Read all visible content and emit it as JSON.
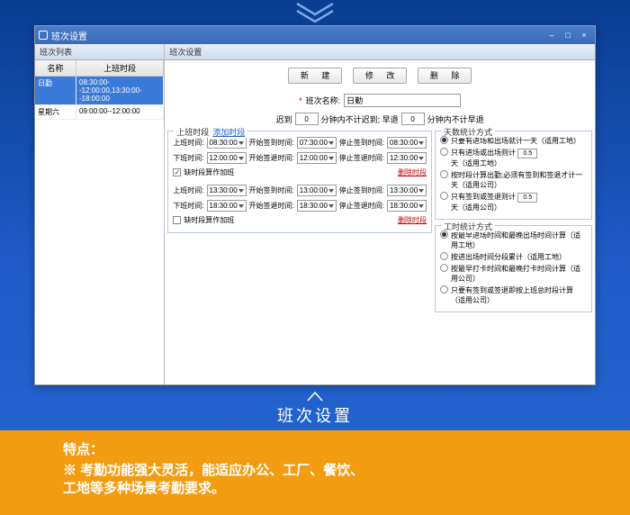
{
  "window": {
    "title": "班次设置"
  },
  "titlebar_buttons": {
    "min": "–",
    "max": "□",
    "close": "×"
  },
  "left": {
    "panel_title": "班次列表",
    "col_name": "名称",
    "col_time": "上班时段",
    "rows": [
      {
        "name": "日勤",
        "time": "08:30:00--12:00:00,13:30:00--18:00:00"
      },
      {
        "name": "星期六",
        "time": "09:00:00--12:00:00"
      }
    ]
  },
  "right": {
    "panel_title": "班次设置",
    "btn_new": "新  建",
    "btn_edit": "修  改",
    "btn_del": "删  除",
    "name_label": "班次名称:",
    "name_value": "日勤",
    "late_label": "迟到",
    "late_val": "0",
    "late_suffix": "分钟内不计迟到; 早退",
    "early_val": "0",
    "early_suffix": "分钟内不计早退",
    "section_title": "上班时段",
    "add_link": "添加时段",
    "labels": {
      "work": "上班时间:",
      "off": "下班时间:",
      "signin_start": "开始签到时间:",
      "signin_end": "停止签到时间:",
      "signout_start": "开始签退时间:",
      "signout_end": "停止签退时间:",
      "ot_chk": "缺时段算作加班",
      "del": "删除时段"
    },
    "seg1": {
      "work": "08:30:00",
      "signin_start": "07:30:00",
      "signin_end": "08:30:00",
      "off": "12:00:00",
      "signout_start": "12:00:00",
      "signout_end": "12:30:00"
    },
    "seg2": {
      "work": "13:30:00",
      "signin_start": "13:00:00",
      "signin_end": "13:30:00",
      "off": "18:30:00",
      "signout_start": "18:30:00",
      "signout_end": "18:30:00"
    }
  },
  "stats": {
    "title": "天数统计方式",
    "opt1": "只要有进场和出场就计一天（适用工地）",
    "opt2_a": "只有进场或出场则计",
    "opt2_val": "0.5",
    "opt2_b": "天（适用工地）",
    "opt3": "按时段计算出勤;必须有签到和签退才计一天（适用公司）",
    "opt4_a": "只有签到或签退则计",
    "opt4_val": "0.5",
    "opt4_b": "天（适用公司）"
  },
  "hours": {
    "title": "工时统计方式",
    "opt1": "按最早进场时间和最晚出场时间计算（适用工地）",
    "opt2": "按进出场时间分段累计（适用工地）",
    "opt3": "按最早打卡时间和最晚打卡时间计算（适用公司）",
    "opt4": "只要有签到或签退即按上班总时段计算（适用公司）"
  },
  "caption": "班次设置",
  "feature": {
    "title": "特点：",
    "line1": "※ 考勤功能强大灵活，能适应办公、工厂、餐饮、",
    "line2": "工地等多种场景考勤要求。"
  }
}
